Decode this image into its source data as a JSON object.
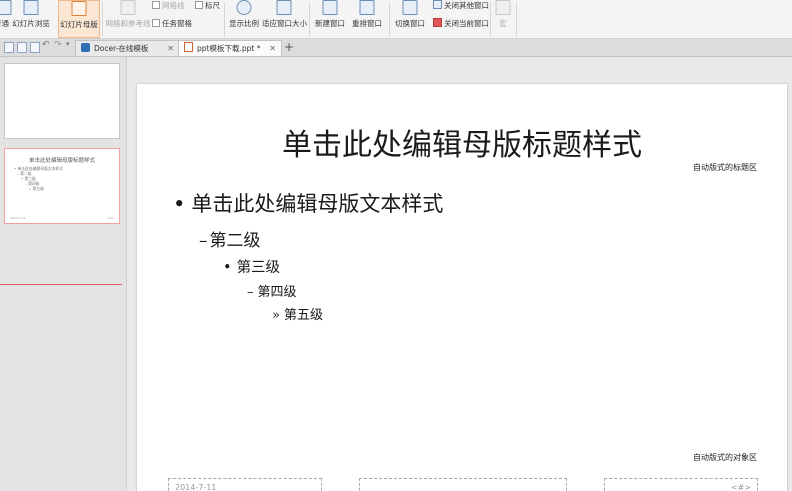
{
  "ribbon": {
    "normal_label": "普通",
    "reading_label": "幻灯片浏览",
    "master_label": "幻灯片母版",
    "notes_label": "备注页",
    "guides_label": "网格和参考线",
    "gridlines_label": "网格线",
    "ruler_label": "标尺",
    "taskpane_label": "任务窗格",
    "zoom_label": "显示比例",
    "fit_label": "适应窗口大小",
    "new_window_label": "新建窗口",
    "arrange_label": "重排窗口",
    "switch_window_label": "切换窗口",
    "close_others_label": "关闭其他窗口",
    "close_current_label": "关闭当前窗口",
    "macro_label": "宏"
  },
  "tabs": [
    {
      "label": "Docer-在线模板",
      "active": false
    },
    {
      "label": "ppt模板下载.ppt *",
      "active": true
    }
  ],
  "thumbnail": {
    "title": "单击此处编辑母版标题样式",
    "lines": [
      "• 单击此处编辑母版文本样式",
      "– 第二级",
      "• 第三级",
      "– 第四级",
      "» 第五级"
    ]
  },
  "slide": {
    "title": "单击此处编辑母版标题样式",
    "title_area_note": "自动版式的标题区",
    "object_area_note": "自动版式的对象区",
    "levels": [
      {
        "marker": "•",
        "text": "单击此处编辑母版文本样式"
      },
      {
        "marker": "–",
        "text": "第二级"
      },
      {
        "marker": "•",
        "text": "第三级"
      },
      {
        "marker": "–",
        "text": "第四级"
      },
      {
        "marker": "»",
        "text": "第五级"
      }
    ],
    "footer_date": "2014-7-11",
    "footer_number": "<#>"
  },
  "colors": {
    "accent": "#f0b98c",
    "active_tab_bg": "#fbfbfb",
    "thumb_selection": "#e65c5c"
  }
}
